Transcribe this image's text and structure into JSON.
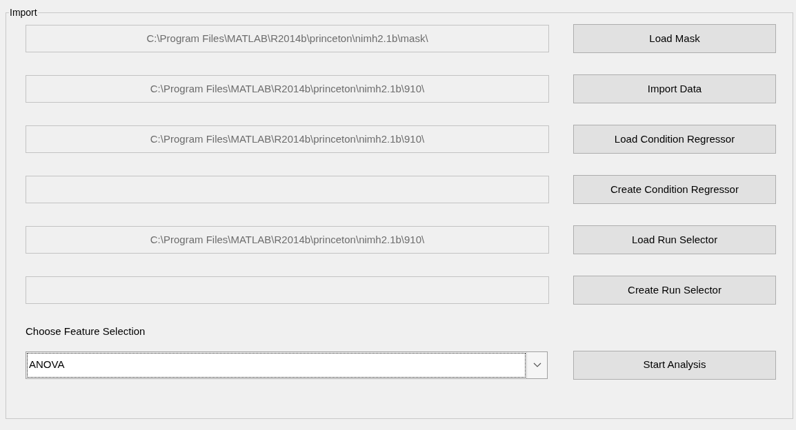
{
  "panel": {
    "title": "Import"
  },
  "rows": [
    {
      "path": "C:\\Program Files\\MATLAB\\R2014b\\princeton\\nimh2.1b\\mask\\",
      "button": "Load Mask"
    },
    {
      "path": "C:\\Program Files\\MATLAB\\R2014b\\princeton\\nimh2.1b\\910\\",
      "button": "Import Data"
    },
    {
      "path": "C:\\Program Files\\MATLAB\\R2014b\\princeton\\nimh2.1b\\910\\",
      "button": "Load Condition Regressor"
    },
    {
      "button": "Create Condition Regressor"
    },
    {
      "path": "C:\\Program Files\\MATLAB\\R2014b\\princeton\\nimh2.1b\\910\\",
      "button": "Load Run Selector"
    },
    {
      "button": "Create Run Selector"
    }
  ],
  "feature_selection": {
    "label": "Choose Feature Selection",
    "value": "ANOVA"
  },
  "start_button": "Start Analysis"
}
